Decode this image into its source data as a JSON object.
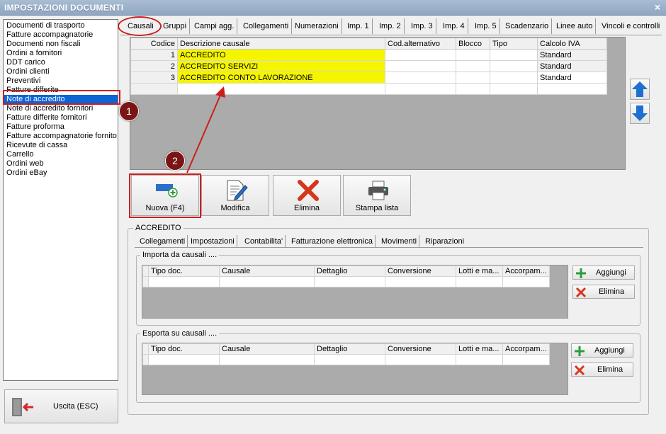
{
  "window": {
    "title": "IMPOSTAZIONI DOCUMENTI",
    "close_glyph": "×"
  },
  "sidebar": {
    "items": [
      "Documenti di trasporto",
      "Fatture accompagnatorie",
      "Documenti non fiscali",
      "Ordini a fornitori",
      "DDT carico",
      "Ordini clienti",
      "Preventivi",
      "Fatture differite",
      "Note di accredito",
      "Note di accredito fornitori",
      "Fatture differite fornitori",
      "Fatture proforma",
      "Fatture accompagnatorie fornito",
      "Ricevute di cassa",
      "Carrello",
      "Ordini web",
      "Ordini eBay"
    ],
    "selected": "Note di accredito",
    "exit_label": "Uscita (ESC)"
  },
  "tabs": [
    "Causali",
    "Gruppi",
    "Campi agg.",
    "Collegamenti",
    "Numerazioni",
    "Imp. 1",
    "Imp. 2",
    "Imp. 3",
    "Imp. 4",
    "Imp. 5",
    "Scadenzario",
    "Linee auto",
    "Vincoli e controlli"
  ],
  "causali_grid": {
    "headers": [
      "Codice",
      "Descrizione causale",
      "Cod.alternativo",
      "Blocco",
      "Tipo",
      "Calcolo IVA"
    ],
    "rows": [
      [
        "1",
        "ACCREDITO",
        "",
        "",
        "",
        "Standard"
      ],
      [
        "2",
        "ACCREDITO SERVIZI",
        "",
        "",
        "",
        "Standard"
      ],
      [
        "3",
        "ACCREDITO CONTO LAVORAZIONE",
        "",
        "",
        "",
        "Standard"
      ]
    ]
  },
  "actions": {
    "new": "Nuova (F4)",
    "edit": "Modifica",
    "delete": "Elimina",
    "print": "Stampa lista"
  },
  "detail": {
    "group_title": "ACCREDITO",
    "subtabs": [
      "Collegamenti",
      "Impostazioni",
      "Contabilita'",
      "Fatturazione elettronica",
      "Movimenti",
      "Riparazioni"
    ],
    "import_title": "Importa da causali ....",
    "export_title": "Esporta su causali ....",
    "link_headers": [
      "Tipo doc.",
      "Causale",
      "Dettaglio",
      "Conversione",
      "Lotti e ma...",
      "Accorpam..."
    ],
    "add_label": "Aggiungi",
    "remove_label": "Elimina"
  },
  "annotations": {
    "step1": "1",
    "step2": "2"
  },
  "colors": {
    "highlight": "#f5f500",
    "selection": "#0a64d6",
    "annotation_red": "#cc1e1e",
    "badge": "#7a1515"
  }
}
